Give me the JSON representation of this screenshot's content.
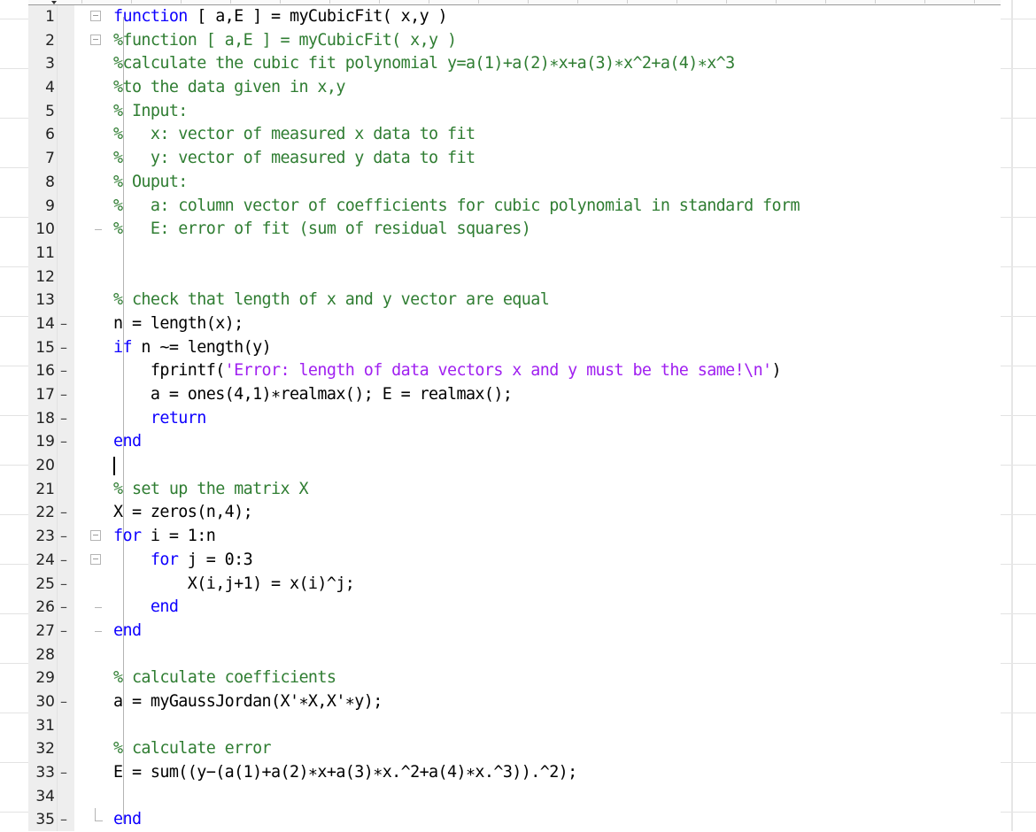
{
  "editor": {
    "language": "MATLAB",
    "cursor_line": 20,
    "lines": [
      {
        "n": "1",
        "exec": false,
        "fold": "open",
        "tokens": [
          {
            "t": "function",
            "c": "kw"
          },
          {
            "t": " [ a,E ] = myCubicFit( x,y )",
            "c": ""
          }
        ]
      },
      {
        "n": "2",
        "exec": false,
        "fold": "open",
        "tokens": [
          {
            "t": "%function [ a,E ] = myCubicFit( x,y )",
            "c": "cm"
          }
        ]
      },
      {
        "n": "3",
        "exec": false,
        "tokens": [
          {
            "t": "%calculate the cubic fit polynomial y=a(1)+a(2)∗x+a(3)∗x^2+a(4)∗x^3",
            "c": "cm"
          }
        ]
      },
      {
        "n": "4",
        "exec": false,
        "tokens": [
          {
            "t": "%to the data given in x,y",
            "c": "cm"
          }
        ]
      },
      {
        "n": "5",
        "exec": false,
        "tokens": [
          {
            "t": "% Input:",
            "c": "cm"
          }
        ]
      },
      {
        "n": "6",
        "exec": false,
        "tokens": [
          {
            "t": "%   x: vector of measured x data to fit",
            "c": "cm"
          }
        ]
      },
      {
        "n": "7",
        "exec": false,
        "tokens": [
          {
            "t": "%   y: vector of measured y data to fit",
            "c": "cm"
          }
        ]
      },
      {
        "n": "8",
        "exec": false,
        "tokens": [
          {
            "t": "% Ouput:",
            "c": "cm"
          }
        ]
      },
      {
        "n": "9",
        "exec": false,
        "tokens": [
          {
            "t": "%   a: column vector of coefficients for cubic polynomial in standard form",
            "c": "cm"
          }
        ]
      },
      {
        "n": "10",
        "exec": false,
        "fold": "end",
        "tokens": [
          {
            "t": "%   E: error of fit (sum of residual squares)",
            "c": "cm"
          }
        ]
      },
      {
        "n": "11",
        "exec": false,
        "tokens": []
      },
      {
        "n": "12",
        "exec": false,
        "tokens": []
      },
      {
        "n": "13",
        "exec": false,
        "tokens": [
          {
            "t": "% check that length of x and y vector are equal",
            "c": "cm"
          }
        ]
      },
      {
        "n": "14",
        "exec": true,
        "tokens": [
          {
            "t": "n = length(x);",
            "c": ""
          }
        ]
      },
      {
        "n": "15",
        "exec": true,
        "tokens": [
          {
            "t": "if",
            "c": "kw"
          },
          {
            "t": " n ~= length(y)",
            "c": ""
          }
        ]
      },
      {
        "n": "16",
        "exec": true,
        "tokens": [
          {
            "t": "    fprintf(",
            "c": ""
          },
          {
            "t": "'Error: length of data vectors x and y must be the same!\\n'",
            "c": "str"
          },
          {
            "t": ")",
            "c": ""
          }
        ]
      },
      {
        "n": "17",
        "exec": true,
        "tokens": [
          {
            "t": "    a = ones(4,1)∗realmax(); E = realmax();",
            "c": ""
          }
        ]
      },
      {
        "n": "18",
        "exec": true,
        "tokens": [
          {
            "t": "    ",
            "c": ""
          },
          {
            "t": "return",
            "c": "kw"
          }
        ]
      },
      {
        "n": "19",
        "exec": true,
        "tokens": [
          {
            "t": "end",
            "c": "kw"
          }
        ]
      },
      {
        "n": "20",
        "exec": false,
        "tokens": []
      },
      {
        "n": "21",
        "exec": false,
        "tokens": [
          {
            "t": "% set up the matrix X",
            "c": "cm"
          }
        ]
      },
      {
        "n": "22",
        "exec": true,
        "tokens": [
          {
            "t": "X = zeros(n,4);",
            "c": ""
          }
        ]
      },
      {
        "n": "23",
        "exec": true,
        "fold": "open",
        "tokens": [
          {
            "t": "for",
            "c": "kw"
          },
          {
            "t": " i = 1:n",
            "c": ""
          }
        ]
      },
      {
        "n": "24",
        "exec": true,
        "fold": "open",
        "tokens": [
          {
            "t": "    ",
            "c": ""
          },
          {
            "t": "for",
            "c": "kw"
          },
          {
            "t": " j = 0:3",
            "c": ""
          }
        ]
      },
      {
        "n": "25",
        "exec": true,
        "tokens": [
          {
            "t": "        X(i,j+1) = x(i)^j;",
            "c": ""
          }
        ]
      },
      {
        "n": "26",
        "exec": true,
        "fold": "end",
        "tokens": [
          {
            "t": "    ",
            "c": ""
          },
          {
            "t": "end",
            "c": "kw"
          }
        ]
      },
      {
        "n": "27",
        "exec": true,
        "fold": "end",
        "tokens": [
          {
            "t": "end",
            "c": "kw"
          }
        ]
      },
      {
        "n": "28",
        "exec": false,
        "tokens": []
      },
      {
        "n": "29",
        "exec": false,
        "tokens": [
          {
            "t": "% calculate coefficients",
            "c": "cm"
          }
        ]
      },
      {
        "n": "30",
        "exec": true,
        "tokens": [
          {
            "t": "a = myGaussJordan(X'∗X,X'∗y);",
            "c": ""
          }
        ]
      },
      {
        "n": "31",
        "exec": false,
        "tokens": []
      },
      {
        "n": "32",
        "exec": false,
        "tokens": [
          {
            "t": "% calculate error",
            "c": "cm"
          }
        ]
      },
      {
        "n": "33",
        "exec": true,
        "tokens": [
          {
            "t": "E = sum((y−(a(1)+a(2)∗x+a(3)∗x.^2+a(4)∗x.^3)).^2);",
            "c": ""
          }
        ]
      },
      {
        "n": "34",
        "exec": false,
        "tokens": []
      },
      {
        "n": "35",
        "exec": true,
        "fold": "corner",
        "tokens": [
          {
            "t": "end",
            "c": "kw"
          }
        ]
      }
    ],
    "exec_marker": "–",
    "colors": {
      "keyword": "#0e00ff",
      "comment": "#2f7d32",
      "string": "#a020f0",
      "text": "#000000",
      "gutter": "#eeeeee"
    }
  }
}
